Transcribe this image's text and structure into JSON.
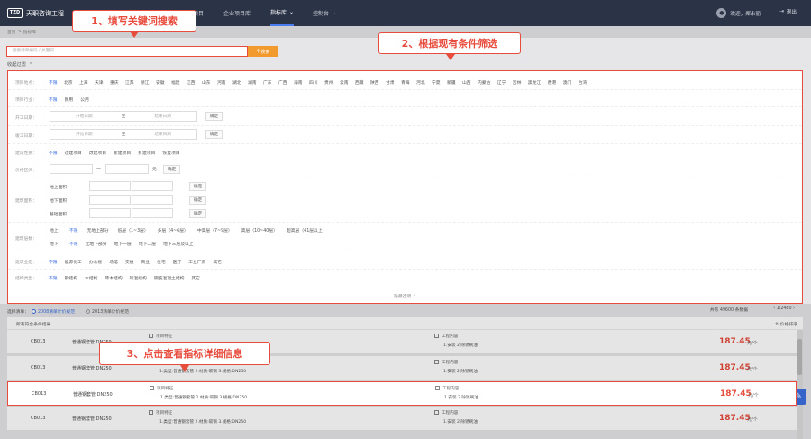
{
  "topbar": {
    "logo": "TZD",
    "app_name": "天职咨询工程",
    "nav": [
      "项目",
      "企业项目库",
      "指标库",
      "控制台"
    ],
    "nav_active_index": 2,
    "user": "欢迎，郑永丽",
    "logout": "退出"
  },
  "breadcrumb": [
    "首页",
    "指标库"
  ],
  "search": {
    "placeholder": "搜索清单编码 / 关键词",
    "button": "搜索"
  },
  "filter_toggle": "收起过滤",
  "filters": {
    "region": {
      "label": "项目地点：",
      "options": [
        "不限",
        "北京",
        "上海",
        "天津",
        "重庆",
        "江苏",
        "浙江",
        "安徽",
        "福建",
        "江西",
        "山东",
        "河南",
        "湖北",
        "湖南",
        "广东",
        "广西",
        "海南",
        "四川",
        "贵州",
        "云南",
        "西藏",
        "陕西",
        "甘肃",
        "青海",
        "河北",
        "宁夏",
        "新疆",
        "山西",
        "内蒙古",
        "辽宁",
        "吉林",
        "黑龙江",
        "香港",
        "澳门",
        "台湾"
      ]
    },
    "industry": {
      "label": "项目行业：",
      "options": [
        "不限",
        "民用",
        "公用"
      ]
    },
    "start_date": {
      "label": "开工日期：",
      "from": "开始日期",
      "to_sep": "至",
      "to": "结束日期",
      "confirm": "确定"
    },
    "end_date": {
      "label": "竣工日期：",
      "from": "开始日期",
      "to_sep": "至",
      "to": "结束日期",
      "confirm": "确定"
    },
    "nature": {
      "label": "建设性质：",
      "options": [
        "不限",
        "迁建项目",
        "改建项目",
        "新建项目",
        "扩建项目",
        "恢复项目"
      ]
    },
    "price": {
      "label": "价格区间：",
      "unit": "元",
      "confirm": "确定"
    },
    "area": {
      "label": "建筑面积：",
      "items": [
        {
          "label": "地上面积：",
          "unit": "㎡",
          "confirm": "确定"
        },
        {
          "label": "地下面积：",
          "unit": "㎡",
          "confirm": "确定"
        },
        {
          "label": "基础面积：",
          "unit": "㎡",
          "confirm": "确定"
        }
      ]
    },
    "floors": {
      "label": "建筑层数：",
      "above_label": "地上：",
      "above": [
        "不限",
        "无地上部分",
        "低层（1~3层）",
        "多层（4~6层）",
        "中高层（7~9层）",
        "高层（10~40层）",
        "超高层（41层以上）"
      ],
      "below_label": "地下：",
      "below": [
        "不限",
        "无地下部分",
        "地下一层",
        "地下二层",
        "地下三层及以上"
      ]
    },
    "category": {
      "label": "建筑业态：",
      "options": [
        "不限",
        "能源化工",
        "办公楼",
        "场馆",
        "交通",
        "商业",
        "住宅",
        "医疗",
        "工业厂房",
        "其它"
      ]
    },
    "structure": {
      "label": "结构类型：",
      "options": [
        "不限",
        "钢结构",
        "木结构",
        "砖木结构",
        "砖混结构",
        "钢筋混凝土结构",
        "其它"
      ]
    },
    "collapse": "隐藏选项"
  },
  "source": {
    "label": "选择清单：",
    "options": [
      "2008清单计价规范",
      "2013清单计价规范"
    ],
    "selected": 0
  },
  "total": "共有 49600 条数据",
  "pager": "1/2480",
  "list": {
    "header": "所有符合条件结果",
    "sort": "价格排序"
  },
  "rows": [
    {
      "code": "CB013",
      "name": "普通钢套管 DN250",
      "feat_title": "项目特征",
      "feat": "1.类型:普通钢套管 2.材质:碳钢 3.规格:DN250",
      "work_title": "工程内容",
      "work": "1.安装 2.除锈刷油",
      "price": "187.45",
      "unit": "元/个"
    },
    {
      "code": "CB013",
      "name": "普通钢套管 DN250",
      "feat_title": "项目特征",
      "feat": "1.类型:普通钢套管 2.材质:碳钢 3.规格:DN250",
      "work_title": "工程内容",
      "work": "1.安装 2.除锈刷油",
      "price": "187.45",
      "unit": "元/个"
    },
    {
      "code": "CB013",
      "name": "普通钢套管 DN250",
      "feat_title": "项目特征",
      "feat": "1.类型:普通钢套管 2.材质:碳钢 3.规格:DN250",
      "work_title": "工程内容",
      "work": "1.安装 2.除锈刷油",
      "price": "187.45",
      "unit": "元/个"
    },
    {
      "code": "CB013",
      "name": "普通钢套管 DN250",
      "feat_title": "项目特征",
      "feat": "1.类型:普通钢套管 2.材质:碳钢 3.规格:DN250",
      "work_title": "工程内容",
      "work": "1.安装 2.除锈刷油",
      "price": "187.45",
      "unit": "元/个"
    }
  ],
  "callouts": [
    "1、填写关键词搜索",
    "2、根据现有条件筛选",
    "3、点击查看指标详细信息"
  ],
  "colors": {
    "accent": "#e84c3d",
    "primary": "#3b6fe0",
    "search_btn": "#f29a2e",
    "topbar": "#2b3346"
  }
}
